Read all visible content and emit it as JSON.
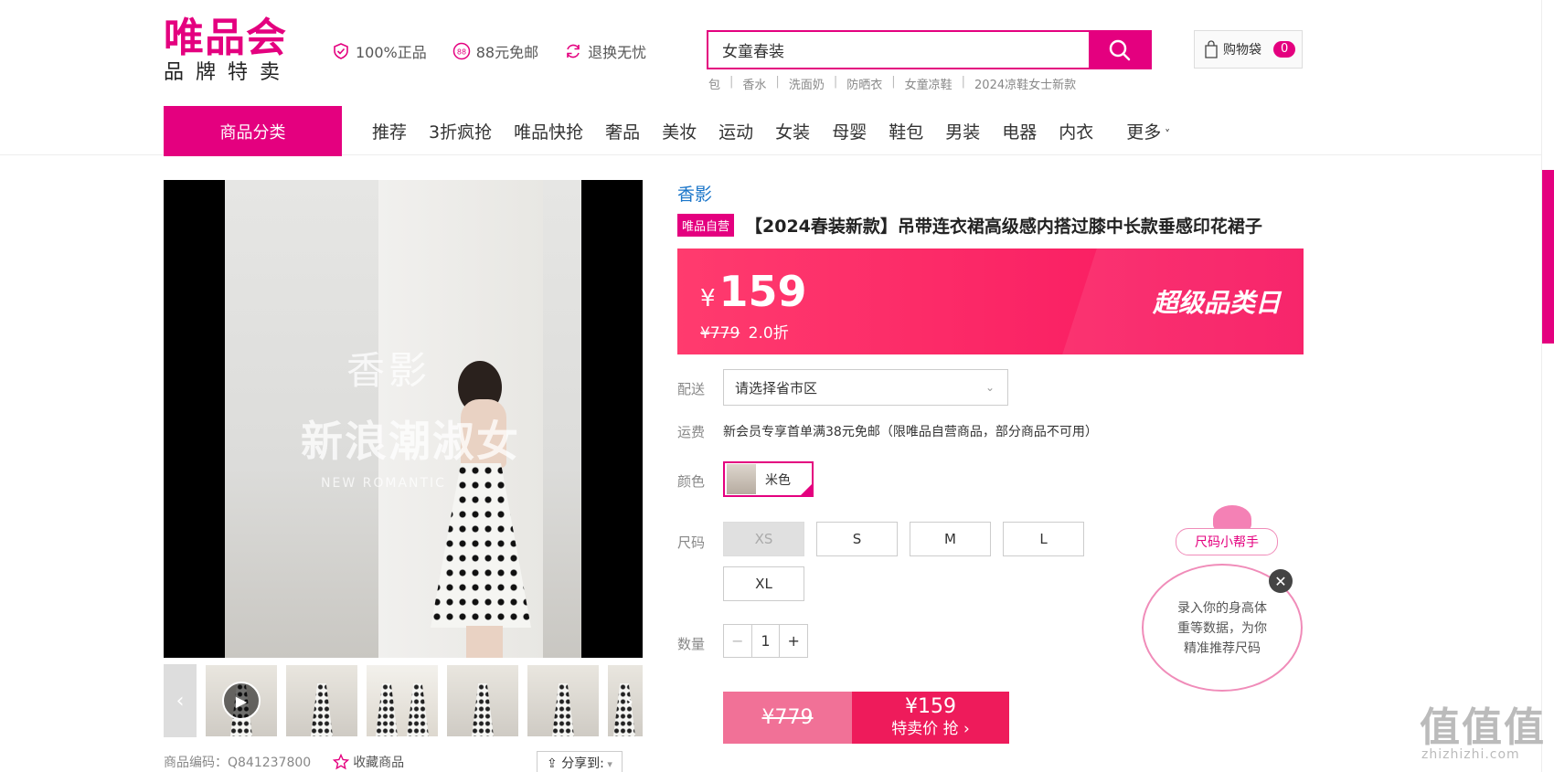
{
  "logo": {
    "main": "唯品会",
    "sub": "品牌特卖"
  },
  "promises": [
    {
      "icon": "shield-check-icon",
      "label": "100%正品"
    },
    {
      "icon": "free-shipping-88-icon",
      "label": "88元免邮"
    },
    {
      "icon": "refresh-icon",
      "label": "退换无忧"
    }
  ],
  "search": {
    "value": "女童春装",
    "hot_words": [
      "包",
      "香水",
      "洗面奶",
      "防晒衣",
      "女童凉鞋",
      "2024凉鞋女士新款"
    ]
  },
  "cart": {
    "label": "购物袋",
    "count": "0"
  },
  "nav": {
    "category_label": "商品分类",
    "items": [
      "推荐",
      "3折疯抢",
      "唯品快抢",
      "奢品",
      "美妆",
      "运动",
      "女装",
      "母婴",
      "鞋包",
      "男装",
      "电器",
      "内衣",
      "更多"
    ]
  },
  "gallery": {
    "watermark_top": "香影",
    "watermark_mid": "新浪潮淑女",
    "watermark_bottom": "NEW ROMANTIC",
    "thumb_count": 6
  },
  "meta": {
    "code_label": "商品编码：Q841237800",
    "favorite_label": "收藏商品",
    "share_label": "分享到:"
  },
  "product": {
    "brand": "香影",
    "self_tag": "唯品自营",
    "title": "【2024春装新款】吊带连衣裙高级感内搭过膝中长款垂感印花裙子",
    "price": "159",
    "currency": "¥",
    "original_price": "¥779",
    "discount": "2.0折",
    "event_label": "超级品类日"
  },
  "shipping": {
    "label": "配送",
    "placeholder": "请选择省市区"
  },
  "freight": {
    "label": "运费",
    "text": "新会员专享首单满38元免邮（限唯品自营商品，部分商品不可用）"
  },
  "color": {
    "label": "颜色",
    "selected": "米色"
  },
  "size": {
    "label": "尺码",
    "options": [
      "XS",
      "S",
      "M",
      "L",
      "XL"
    ],
    "disabled": [
      "XS"
    ]
  },
  "quantity": {
    "label": "数量",
    "value": "1",
    "minus": "−",
    "plus": "+"
  },
  "buy": {
    "original_price": "¥779",
    "price": "¥159",
    "action": "特卖价 抢"
  },
  "size_helper": {
    "tag": "尺码小帮手",
    "text_line1": "录入你的身高体",
    "text_line2": "重等数据，为你",
    "text_line3": "精准推荐尺码"
  },
  "watermark": {
    "site_logo": "值值值",
    "site_url": "zhizhizhi.com"
  },
  "colors": {
    "brand": "#e4007f",
    "price_gradient_start": "#ff3b6e",
    "price_gradient_end": "#f7135f"
  }
}
